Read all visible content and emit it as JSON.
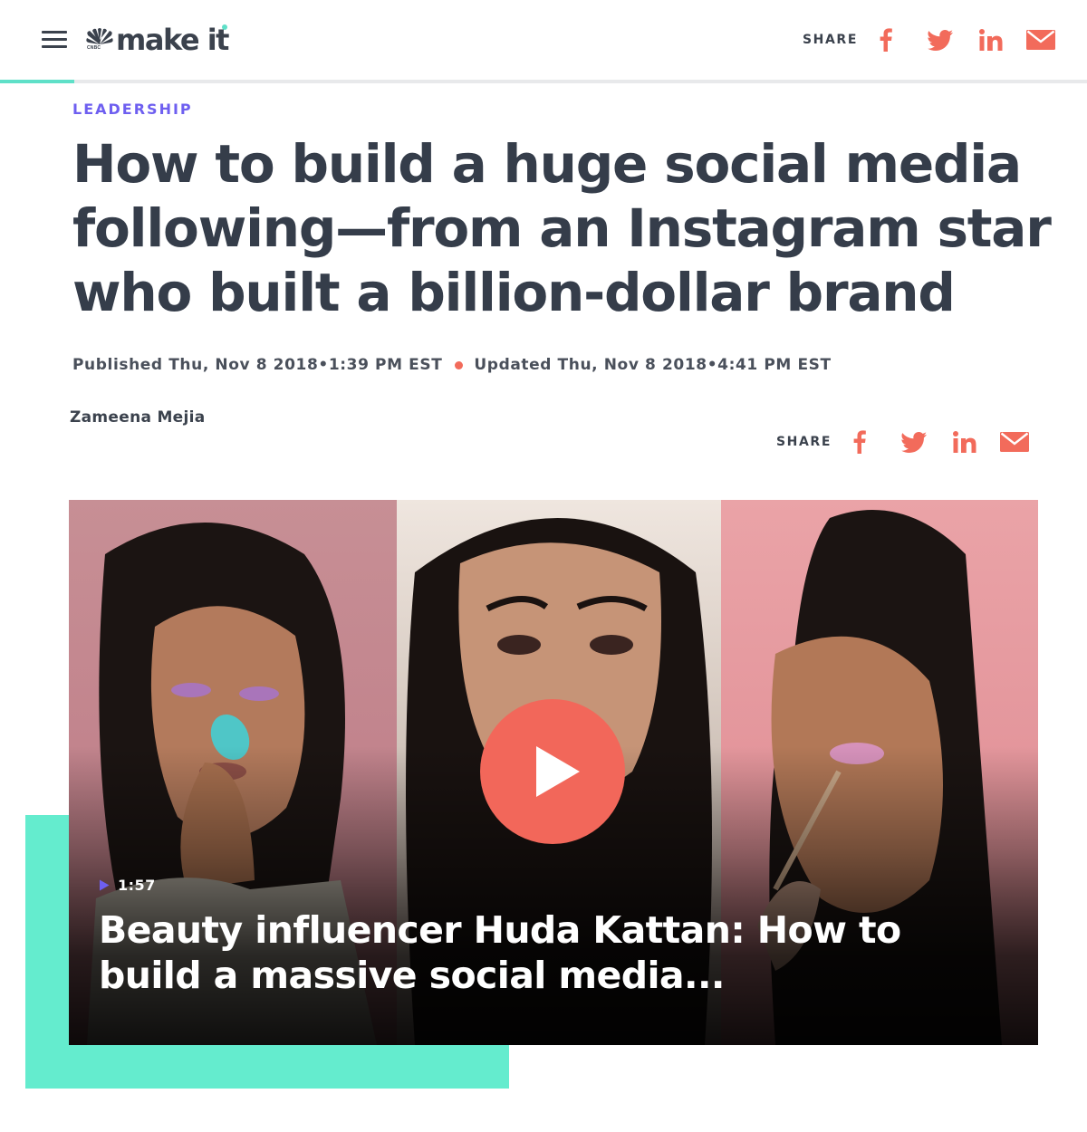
{
  "header": {
    "logo": {
      "brand": "CNBC",
      "name": "make it"
    },
    "share_label": "SHARE",
    "share_icons": [
      "facebook-icon",
      "twitter-icon",
      "linkedin-icon",
      "mail-icon"
    ]
  },
  "article": {
    "section": "LEADERSHIP",
    "headline": "How to build a huge social media following—from an Instagram star who built a billion-dollar brand",
    "published": "Published Thu, Nov 8 2018•1:39 PM EST",
    "updated": "Updated Thu, Nov 8 2018•4:41 PM EST",
    "author": "Zameena Mejia",
    "share_label": "SHARE"
  },
  "video": {
    "duration": "1:57",
    "title": "Beauty influencer Huda Kattan: How to build a massive social media..."
  },
  "colors": {
    "text": "#353d4a",
    "kicker": "#6e5ff0",
    "social": "#f26b5b",
    "accent": "#64ecce",
    "play_button": "#f2675a"
  }
}
